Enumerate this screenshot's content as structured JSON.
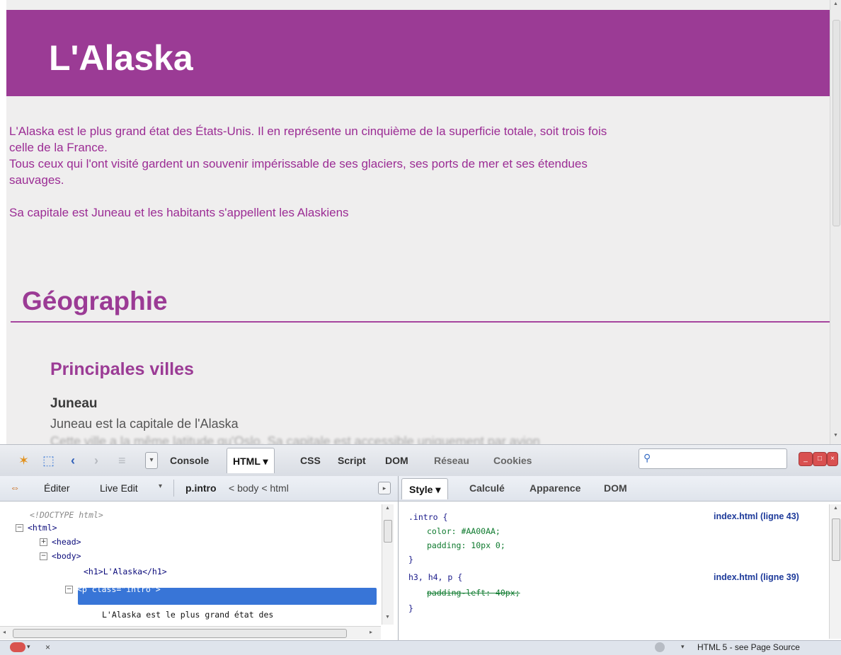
{
  "page": {
    "title": "L'Alaska",
    "intro_lines": [
      "L'Alaska est le plus grand état des États-Unis. Il en représente un cinquième de la superficie totale, soit trois fois",
      "celle de la France.",
      "Tous ceux qui l'ont visité gardent un souvenir impérissable de ses glaciers, ses ports de mer et ses étendues",
      "sauvages."
    ],
    "intro_capital": "Sa capitale est Juneau et les habitants s'appellent les Alaskiens",
    "h2": "Géographie",
    "h3": "Principales villes",
    "h4": "Juneau",
    "p_juneau": "Juneau est la capitale de l'Alaska",
    "p_cut": "Cette ville a la même latitude qu'Oslo. Sa capitale est accessible uniquement par avion"
  },
  "firebug": {
    "tabs": [
      "Console",
      "HTML ▾",
      "CSS",
      "Script",
      "DOM",
      "Réseau",
      "Cookies"
    ],
    "active_tab": "HTML ▾",
    "left_toolbar": {
      "edit": "Éditer",
      "live_edit": "Live Edit",
      "crumb_current": "p.intro",
      "crumb_rest": "< body < html"
    },
    "tree": [
      "<!DOCTYPE html>",
      "<html>",
      "<head>",
      "<body>",
      "<h1>L'Alaska</h1>",
      "<p class=\"intro\">",
      "L'Alaska est le plus grand état des"
    ],
    "right_tabs": [
      "Style ▾",
      "Calculé",
      "Apparence",
      "DOM"
    ],
    "rules": [
      {
        "selector": ".intro {",
        "decls": [
          "color: #AA00AA;",
          "padding: 10px 0;"
        ],
        "close": "}",
        "source": "index.html (ligne 43)"
      },
      {
        "selector": "h3, h4, p {",
        "decls": [
          "padding-left: 40px;"
        ],
        "close": "}",
        "source": "index.html (ligne 39)"
      }
    ],
    "status": {
      "left": "×",
      "right": "HTML 5 - see Page Source"
    }
  },
  "colors": {
    "accent": "#9b3b95",
    "selection": "#3875d7",
    "source_link": "#1d3a9a"
  }
}
